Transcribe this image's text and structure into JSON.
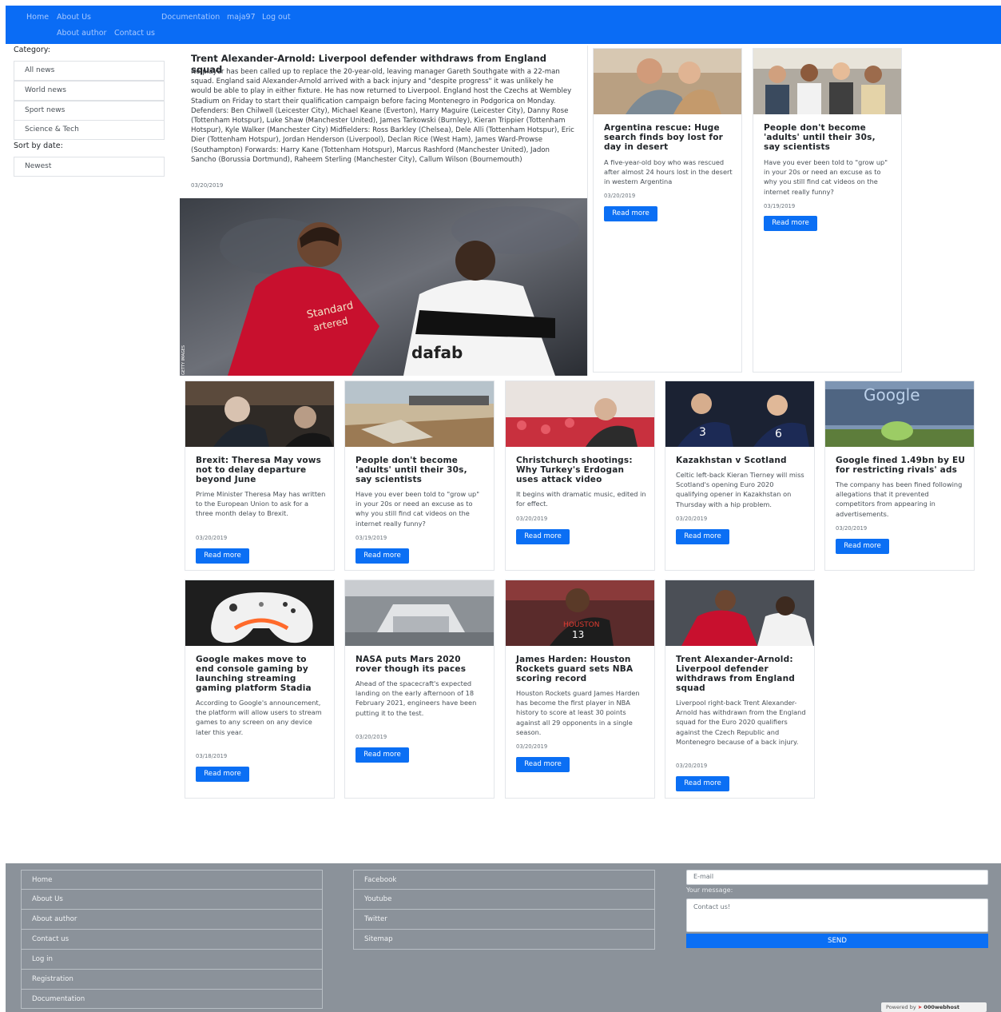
{
  "nav": {
    "home": "Home",
    "about_us": "About Us",
    "documentation": "Documentation",
    "user": "maja97",
    "logout": "Log out",
    "about_author": "About author",
    "contact_us": "Contact us"
  },
  "sidebar": {
    "category_label": "Category:",
    "categories": [
      "All news",
      "World news",
      "Sport news",
      "Science & Tech"
    ],
    "sort_label": "Sort by date:",
    "sort_value": "Newest"
  },
  "featured": {
    "title": "Trent Alexander-Arnold: Liverpool defender withdraws from England squad",
    "body": "No player has been called up to replace the 20-year-old, leaving manager Gareth Southgate with a 22-man squad. England said Alexander-Arnold arrived with a back injury and \"despite progress\" it was unlikely he would be able to play in either fixture. He has now returned to Liverpool. England host the Czechs at Wembley Stadium on Friday to start their qualification campaign before facing Montenegro in Podgorica on Monday. Defenders: Ben Chilwell (Leicester City), Michael Keane (Everton), Harry Maguire (Leicester City), Danny Rose (Tottenham Hotspur), Luke Shaw (Manchester United), James Tarkowski (Burnley), Kieran Trippier (Tottenham Hotspur), Kyle Walker (Manchester City) Midfielders: Ross Barkley (Chelsea), Dele Alli (Tottenham Hotspur), Eric Dier (Tottenham Hotspur), Jordan Henderson (Liverpool), Declan Rice (West Ham), James Ward-Prowse (Southampton) Forwards: Harry Kane (Tottenham Hotspur), Marcus Rashford (Manchester United), Jadon Sancho (Borussia Dortmund), Raheem Sterling (Manchester City), Callum Wilson (Bournemouth)",
    "date": "03/20/2019",
    "image_credit": "GETTY IMAGES"
  },
  "read_more": "Read more",
  "cards": [
    {
      "title": "Argentina rescue: Huge search finds boy lost for day in desert",
      "text": "A five-year-old boy who was rescued after almost 24 hours lost in the desert in western Argentina",
      "date": "03/20/2019"
    },
    {
      "title": "People don't become 'adults' until their 30s, say scientists",
      "text": "Have you ever been told to \"grow up\" in your 20s or need an excuse as to why you still find cat videos on the internet really funny?",
      "date": "03/19/2019"
    },
    {
      "title": "Brexit: Theresa May vows not to delay departure beyond June",
      "text": "Prime Minister Theresa May has written to the European Union to ask for a three month delay to Brexit.",
      "date": "03/20/2019"
    },
    {
      "title": "People don't become 'adults' until their 30s, say scientists",
      "text": "Have you ever been told to \"grow up\" in your 20s or need an excuse as to why you still find cat videos on the internet really funny?",
      "date": "03/19/2019"
    },
    {
      "title": "Christchurch shootings: Why Turkey's Erdogan uses attack video",
      "text": "It begins with dramatic music, edited in for effect.",
      "date": "03/20/2019"
    },
    {
      "title": "Kazakhstan v Scotland",
      "text": "Celtic left-back Kieran Tierney will miss Scotland's opening Euro 2020 qualifying opener in Kazakhstan on Thursday with a hip problem.",
      "date": "03/20/2019"
    },
    {
      "title": "Google fined 1.49bn by EU for restricting rivals' ads",
      "text": "The company has been fined following allegations that it prevented competitors from appearing in advertisements.",
      "date": "03/20/2019"
    },
    {
      "title": "Google makes move to end console gaming by launching streaming gaming platform Stadia",
      "text": "According to Google's announcement, the platform will allow users to stream games to any screen on any device later this year.",
      "date": "03/18/2019"
    },
    {
      "title": "NASA puts Mars 2020 rover though its paces",
      "text": "Ahead of the spacecraft's expected landing on the early afternoon of 18 February 2021, engineers have been putting it to the test.",
      "date": "03/20/2019"
    },
    {
      "title": "James Harden: Houston Rockets guard sets NBA scoring record",
      "text": "Houston Rockets guard James Harden has become the first player in NBA history to score at least 30 points against all 29 opponents in a single season.",
      "date": "03/20/2019"
    },
    {
      "title": "Trent Alexander-Arnold: Liverpool defender withdraws from England squad",
      "text": "Liverpool right-back Trent Alexander-Arnold has withdrawn from the England squad for the Euro 2020 qualifiers against the Czech Republic and Montenegro because of a back injury.",
      "date": "03/20/2019"
    }
  ],
  "image_text": {
    "google_sign": "Google",
    "jersey_houston": "HOUSTON",
    "jersey_13": "13",
    "jersey_3": "3",
    "jersey_6": "6"
  },
  "footer": {
    "links_left": [
      "Home",
      "About Us",
      "About author",
      "Contact us",
      "Log in",
      "Registration",
      "Documentation"
    ],
    "links_right": [
      "Facebook",
      "Youtube",
      "Twitter",
      "Sitemap"
    ],
    "email_placeholder": "E-mail",
    "message_label": "Your message:",
    "message_placeholder": "Contact us!",
    "send": "SEND",
    "powered_by": "Powered by",
    "host": "000webhost"
  },
  "colors": {
    "navbar": "#0a6cf5",
    "button": "#0b6ff4",
    "footer": "#8b929a"
  }
}
